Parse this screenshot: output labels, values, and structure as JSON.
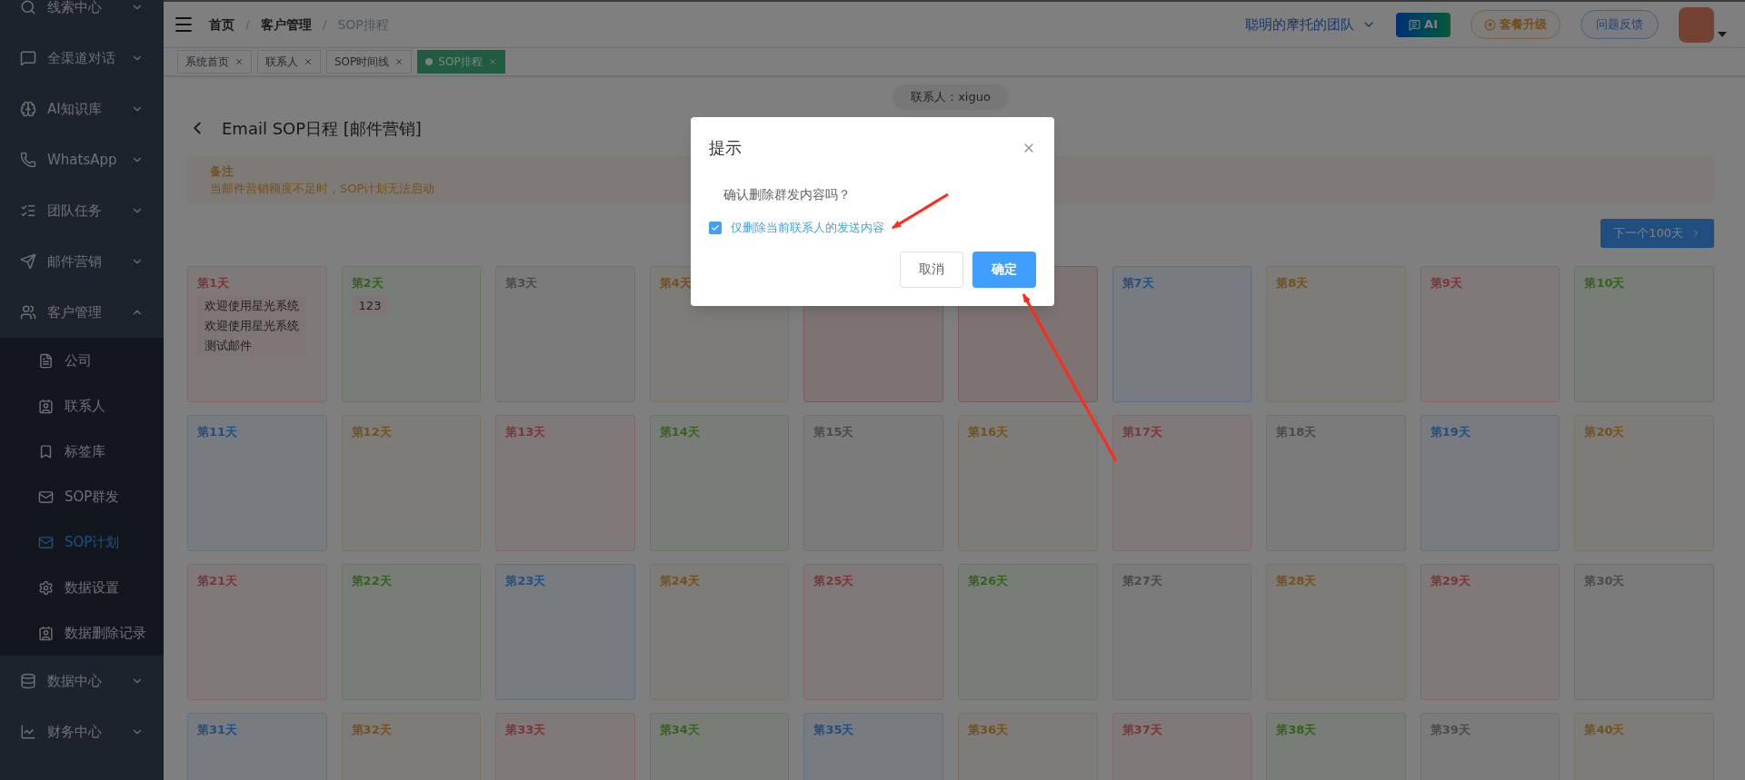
{
  "sidebar": {
    "items": [
      {
        "label": "线索中心",
        "expanded": false
      },
      {
        "label": "全渠道对话",
        "expanded": false
      },
      {
        "label": "AI知识库",
        "expanded": false
      },
      {
        "label": "WhatsApp",
        "expanded": false
      },
      {
        "label": "团队任务",
        "expanded": false
      },
      {
        "label": "邮件营销",
        "expanded": false
      },
      {
        "label": "客户管理",
        "expanded": true,
        "children": [
          {
            "label": "公司",
            "selected": false
          },
          {
            "label": "联系人",
            "selected": false
          },
          {
            "label": "标签库",
            "selected": false
          },
          {
            "label": "SOP群发",
            "selected": false
          },
          {
            "label": "SOP计划",
            "selected": true
          },
          {
            "label": "数据设置",
            "selected": false
          },
          {
            "label": "数据删除记录",
            "selected": false
          }
        ]
      },
      {
        "label": "数据中心",
        "expanded": false
      },
      {
        "label": "财务中心",
        "expanded": false
      }
    ]
  },
  "header": {
    "breadcrumb": [
      {
        "kind": "link",
        "text": "首页"
      },
      {
        "kind": "separator",
        "text": "/"
      },
      {
        "kind": "link",
        "text": "客户管理"
      },
      {
        "kind": "separator",
        "text": "/"
      },
      {
        "kind": "current",
        "text": "SOP排程"
      }
    ],
    "team": "聪明的摩托的团队",
    "ai_button": "AI",
    "upgrade_button": "套餐升级",
    "feedback_button": "问题反馈"
  },
  "tabs": [
    {
      "label": "系统首页",
      "selected": false
    },
    {
      "label": "联系人",
      "selected": false
    },
    {
      "label": "SOP时间线",
      "selected": false
    },
    {
      "label": "SOP排程",
      "selected": true
    }
  ],
  "contact_pill": "联系人：xiguo",
  "page_title": "Email SOP日程 [邮件营销]",
  "notice": {
    "title": "备注",
    "text": "当邮件营销额度不足时，SOP计划无法启动"
  },
  "next_button": "下一个100天",
  "days": [
    {
      "label": "第1天",
      "color": "#7b3636",
      "entries": [
        "欢迎使用星光系统",
        "欢迎使用星光系统",
        "测试邮件"
      ]
    },
    {
      "label": "第2天",
      "color": "#34611d",
      "entries": [
        "123"
      ]
    },
    {
      "label": "第3天",
      "color": "#484a4c"
    },
    {
      "label": "第4天",
      "color": "#73511e"
    },
    {
      "kind": "covered"
    },
    {
      "kind": "covered"
    },
    {
      "label": "第7天",
      "color": "#204f80"
    },
    {
      "label": "第8天",
      "color": "#73511e"
    },
    {
      "label": "第9天",
      "color": "#7b3636"
    },
    {
      "label": "第10天",
      "color": "#34611d"
    },
    {
      "label": "第11天",
      "color": "#204f80"
    },
    {
      "label": "第12天",
      "color": "#73511e"
    },
    {
      "label": "第13天",
      "color": "#7b3636"
    },
    {
      "label": "第14天",
      "color": "#34611d"
    },
    {
      "label": "第15天",
      "color": "#484a4c"
    },
    {
      "label": "第16天",
      "color": "#73511e"
    },
    {
      "label": "第17天",
      "color": "#7b3636"
    },
    {
      "label": "第18天",
      "color": "#484a4c"
    },
    {
      "label": "第19天",
      "color": "#204f80"
    },
    {
      "label": "第20天",
      "color": "#73511e"
    },
    {
      "label": "第21天",
      "color": "#7b3636"
    },
    {
      "label": "第22天",
      "color": "#34611d"
    },
    {
      "label": "第23天",
      "color": "#204f80"
    },
    {
      "label": "第24天",
      "color": "#73511e"
    },
    {
      "label": "第25天",
      "color": "#7b3636"
    },
    {
      "label": "第26天",
      "color": "#34611d"
    },
    {
      "label": "第27天",
      "color": "#484a4c"
    },
    {
      "label": "第28天",
      "color": "#73511e"
    },
    {
      "label": "第29天",
      "color": "#7b3636"
    },
    {
      "label": "第30天",
      "color": "#484a4c"
    },
    {
      "label": "第31天",
      "color": "#204f80"
    },
    {
      "label": "第32天",
      "color": "#73511e"
    },
    {
      "label": "第33天",
      "color": "#7b3636"
    },
    {
      "label": "第34天",
      "color": "#34611d"
    },
    {
      "label": "第35天",
      "color": "#204f80"
    },
    {
      "label": "第36天",
      "color": "#73511e"
    },
    {
      "label": "第37天",
      "color": "#7b3636"
    },
    {
      "label": "第38天",
      "color": "#34611d"
    },
    {
      "label": "第39天",
      "color": "#484a4c"
    },
    {
      "label": "第40天",
      "color": "#73511e"
    }
  ],
  "dialog": {
    "title": "提示",
    "message": "确认删除群发内容吗？",
    "checkbox": {
      "label": "仅删除当前联系人的发送内容",
      "checked": true
    },
    "buttons": [
      {
        "label": "取消",
        "kind": "default"
      },
      {
        "label": "确定",
        "kind": "primary"
      }
    ]
  }
}
